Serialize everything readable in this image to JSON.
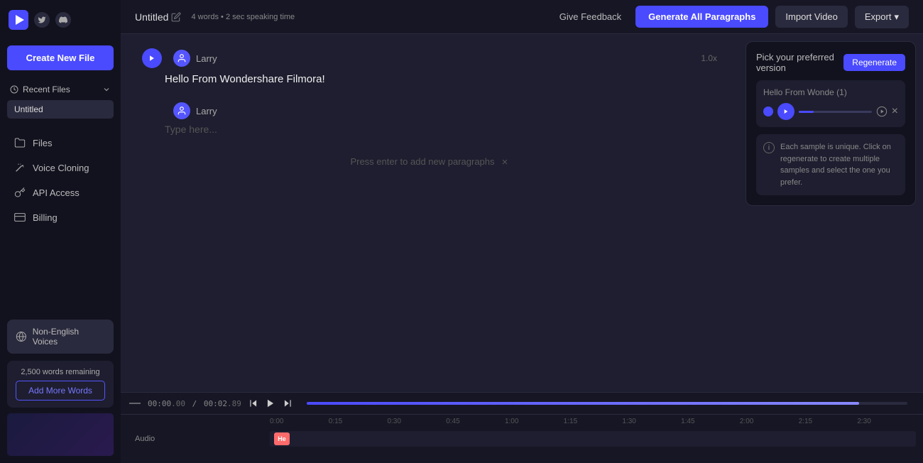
{
  "app": {
    "name": "Playht"
  },
  "header": {
    "file_title": "Untitled",
    "edit_icon": "✎",
    "file_meta": "4 words • 2 sec speaking time",
    "give_feedback_label": "Give Feedback",
    "generate_btn_label": "Generate All Paragraphs",
    "import_video_label": "Import Video",
    "export_label": "Export",
    "export_chevron": "▾"
  },
  "sidebar": {
    "create_btn_label": "Create New File",
    "recent_section_label": "Recent Files",
    "recent_items": [
      {
        "name": "Untitled"
      }
    ],
    "nav_items": [
      {
        "id": "files",
        "label": "Files",
        "icon": "folder"
      },
      {
        "id": "voice-cloning",
        "label": "Voice Cloning",
        "icon": "wand"
      },
      {
        "id": "api-access",
        "label": "API Access",
        "icon": "key"
      },
      {
        "id": "billing",
        "label": "Billing",
        "icon": "card"
      }
    ],
    "non_english_label": "Non-English Voices",
    "words_remaining_text": "2,500 words remaining",
    "add_words_label": "Add More Words"
  },
  "editor": {
    "paragraphs": [
      {
        "voice": "Larry",
        "speed": "1.0x",
        "text": "Hello From Wondershare Filmora!"
      },
      {
        "voice": "Larry",
        "placeholder": "Type here..."
      }
    ],
    "press_enter_hint": "Press enter to add new paragraphs"
  },
  "popover": {
    "title": "Pick your preferred version",
    "regenerate_label": "Regenerate",
    "sample_title": "Hello From Wonde (1)",
    "info_text": "Each sample is unique. Click on regenerate to create multiple samples and select the one you prefer."
  },
  "timeline": {
    "stop_icon": "—",
    "time_current": "00:00",
    "time_ms_current": ".00",
    "time_separator": "/",
    "time_total": "00:02",
    "time_ms_total": ".89",
    "ruler_labels": [
      "0:00",
      "0:15",
      "0:30",
      "0:45",
      "1:00",
      "1:15",
      "1:30",
      "1:45",
      "2:00",
      "2:15",
      "2:30"
    ],
    "audio_track_label": "Audio",
    "audio_block_label": "He"
  }
}
